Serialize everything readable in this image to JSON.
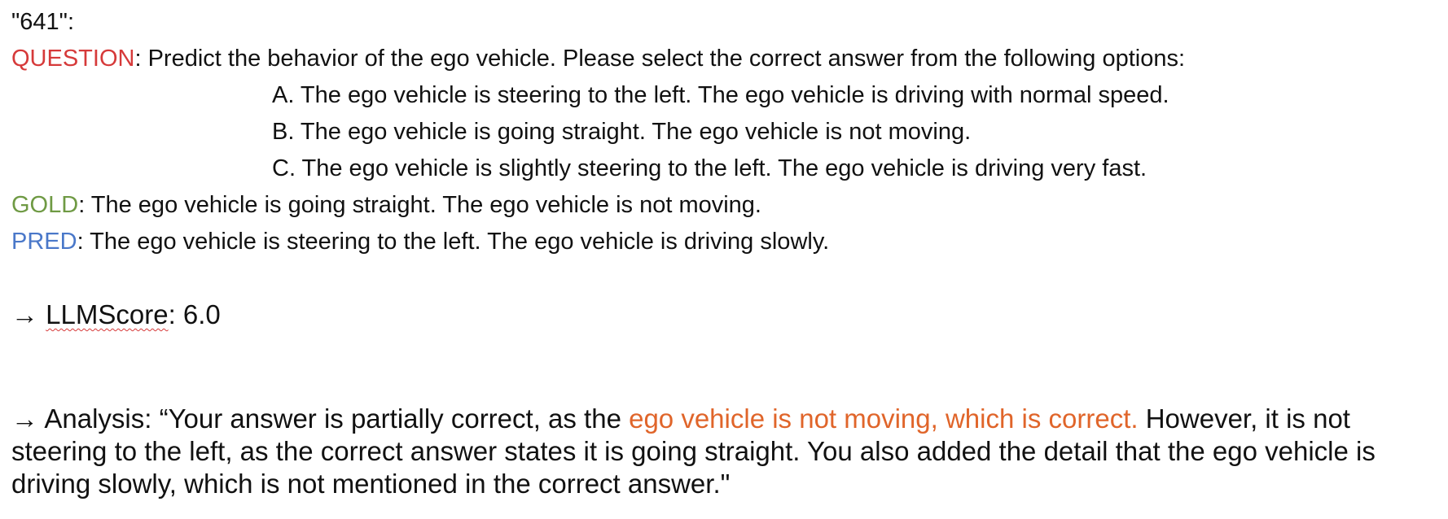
{
  "record_id": "\"641\":",
  "question": {
    "label": "QUESTION",
    "text": ": Predict the behavior of the ego vehicle. Please select the correct answer from the following options:"
  },
  "options": [
    "A. The ego vehicle is steering to the left. The ego vehicle is driving with normal speed.",
    "B. The ego vehicle is going straight. The ego vehicle is not moving.",
    "C. The ego vehicle is slightly steering to the left. The ego vehicle is driving very fast."
  ],
  "gold": {
    "label": "GOLD",
    "text": ": The ego vehicle is going straight. The ego vehicle is not moving."
  },
  "pred": {
    "label": "PRED",
    "text": ": The ego vehicle is steering to the left. The ego vehicle is driving slowly."
  },
  "score": {
    "arrow": "→ ",
    "label": "LLMScore",
    "value": ": 6.0"
  },
  "analysis": {
    "arrow": "→ ",
    "prefix": "Analysis: “Your answer is partially correct, as the ",
    "highlight": "ego vehicle is not moving, which is correct.",
    "suffix": " However,  it is not steering to the left, as the correct answer states it is going straight. You also added the detail that the ego vehicle is driving slowly, which is not mentioned in the correct answer.\""
  },
  "colors": {
    "question_label": "#d63a3a",
    "gold_label": "#6f9a44",
    "pred_label": "#4a78c9",
    "highlight": "#e0652a"
  }
}
